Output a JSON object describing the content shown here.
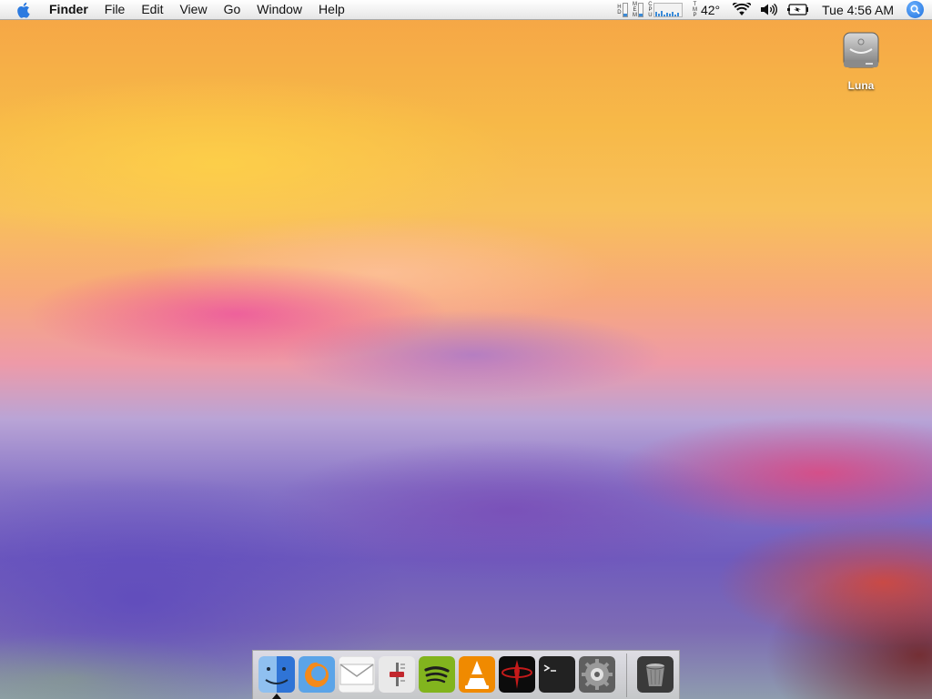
{
  "menubar": {
    "app_name": "Finder",
    "menus": [
      "File",
      "Edit",
      "View",
      "Go",
      "Window",
      "Help"
    ],
    "meters": {
      "hd_label": [
        "H",
        "D"
      ],
      "mem_label": [
        "M",
        "E",
        "M"
      ],
      "cpu_label": [
        "C",
        "P",
        "U"
      ],
      "tmp_label": [
        "T",
        "M",
        "P"
      ]
    },
    "temperature": "42°",
    "clock": "Tue 4:56 AM",
    "icons": [
      "apple-icon",
      "wifi-icon",
      "volume-icon",
      "battery-icon",
      "spotlight-icon"
    ]
  },
  "desktop": {
    "icon_label": "Luna",
    "icon_type": "hard-drive-icon"
  },
  "dock": {
    "apps": [
      "finder-icon",
      "firefox-icon",
      "mail-icon",
      "system-control-icon",
      "spotify-icon",
      "vlc-icon",
      "quake-icon",
      "terminal-icon",
      "system-preferences-icon"
    ],
    "trash": "trash-icon",
    "running": [
      "finder-icon"
    ]
  },
  "colors": {
    "menubar_top": "#ffffff",
    "menubar_bottom": "#e5e5e5",
    "spotlight_blue": "#1d6fdd",
    "meter_blue": "#3b8bd8"
  }
}
